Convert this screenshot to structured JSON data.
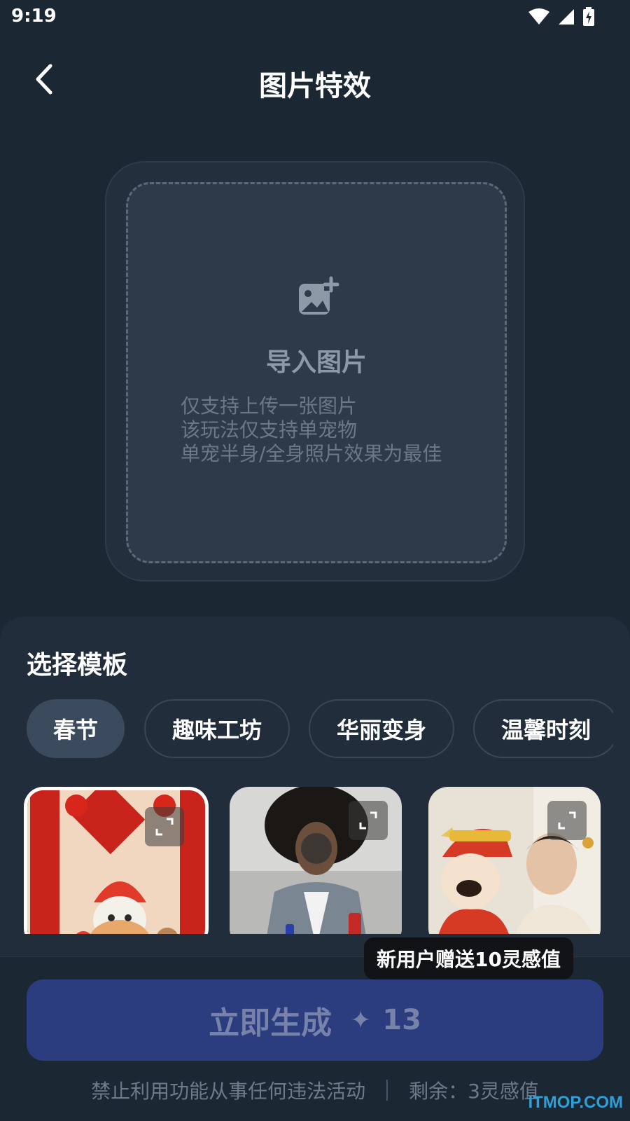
{
  "status_bar": {
    "time": "9:19"
  },
  "header": {
    "title": "图片特效"
  },
  "upload": {
    "title": "导入图片",
    "hints": [
      "仅支持上传一张图片",
      "该玩法仅支持单宠物",
      "单宠半身/全身照片效果为最佳"
    ]
  },
  "templates": {
    "section_title": "选择模板",
    "tabs": [
      {
        "label": "春节",
        "active": true
      },
      {
        "label": "趣味工坊",
        "active": false
      },
      {
        "label": "华丽变身",
        "active": false
      },
      {
        "label": "温馨时刻",
        "active": false
      }
    ],
    "thumbnails": [
      {
        "subject": "cat-in-lion-dance-hat-spring-festival",
        "selected": true
      },
      {
        "subject": "man-with-afro-and-firecracker",
        "selected": false
      },
      {
        "subject": "god-of-wealth-figure-with-man",
        "selected": false
      }
    ]
  },
  "generate": {
    "label": "立即生成",
    "cost": "13",
    "promo": "新用户赠送10灵感值"
  },
  "footer": {
    "notice": "禁止利用功能从事任何违法活动",
    "remaining": "剩余：3灵感值"
  },
  "watermark": "ITMOP.COM",
  "colors": {
    "background": "#1b2733",
    "sheet": "#212d3b",
    "generate_button": "#2b3d7e",
    "active_tab": "#3b4a5c"
  }
}
